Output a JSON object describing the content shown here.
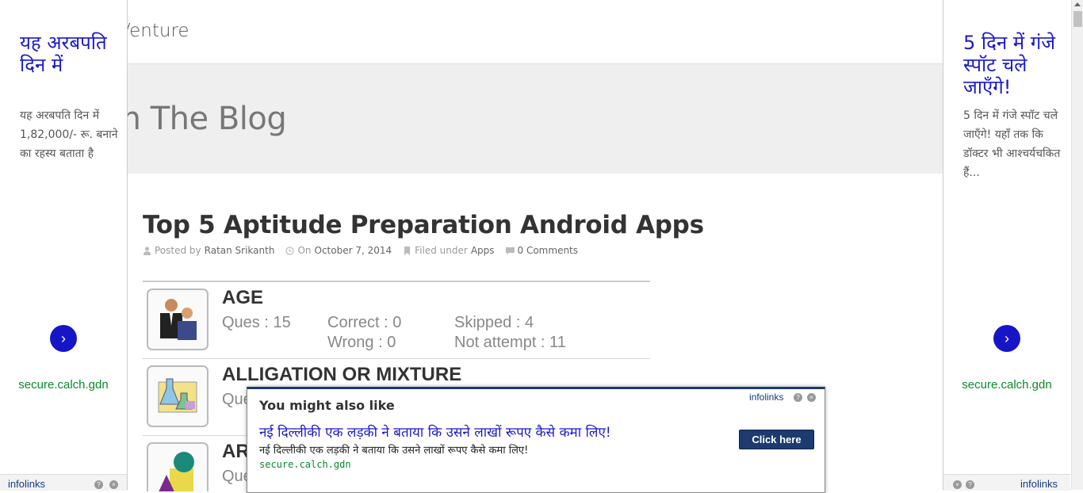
{
  "site": {
    "logo_text": "ndroidVenture",
    "hero_title": "rom The Blog"
  },
  "post": {
    "title": "Top 5 Aptitude Preparation Android Apps",
    "meta": {
      "posted_by_label": "Posted by",
      "author": "Ratan Srikanth",
      "on_label": "On",
      "date": "October 7, 2014",
      "filed_label": "Filed under",
      "category": "Apps",
      "comments": "0 Comments"
    },
    "image_rows": [
      {
        "name": "AGE",
        "ques": "Ques : 15",
        "correct": "Correct : 0",
        "wrong": "Wrong : 0",
        "skipped": "Skipped : 4",
        "not_attempt": "Not attempt : 11",
        "icon": "people-icon"
      },
      {
        "name": "ALLIGATION OR MIXTURE",
        "ques": "Que",
        "icon": "chemistry-flask-icon"
      },
      {
        "name": "AR",
        "ques": "Que",
        "icon": "geometry-shapes-icon"
      }
    ]
  },
  "ad_left": {
    "headline": "यह अरबपति दिन में",
    "body": "यह अरबपति दिन में 1,82,000/- रू. बनाने का रहस्य बताता है",
    "url": "secure.calch.gdn",
    "brand": "infolinks",
    "go_icon": "chevron-right-icon"
  },
  "ad_right": {
    "headline": "5 दिन में गंजे स्पॉट चले जाएँगे!",
    "body": "5 दिन में गंजे स्पॉट चले जाएँगे! यहाँ तक कि डॉक्टर भी आश्चर्यचकित हैं...",
    "url": "secure.calch.gdn",
    "brand": "infolinks",
    "go_icon": "chevron-right-icon"
  },
  "popup": {
    "title": "You might also like",
    "brand": "infolinks",
    "link_text": "नई दिल्लीकी एक लड़की ने बताया कि उसने लाखों रूपए कैसे कमा लिए!",
    "description": "नई दिल्लीकी एक लड़की ने बताया कि उसने लाखों रूपए कैसे कमा लिए!",
    "url": "secure.calch.gdn",
    "button_label": "Click here"
  },
  "colors": {
    "ad_headline": "#1a1acc",
    "ad_url": "#0a8a2a",
    "popup_accent": "#1d3b6e",
    "hero_bg": "#efefef"
  }
}
